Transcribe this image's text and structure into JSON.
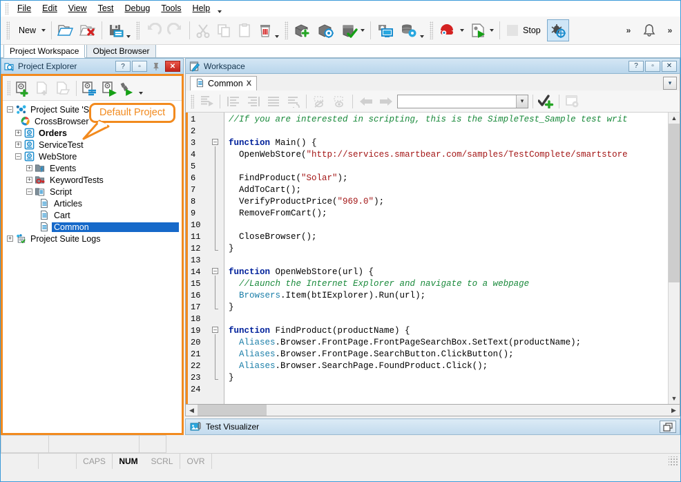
{
  "menubar": {
    "items": [
      {
        "label": "File",
        "accel": "F"
      },
      {
        "label": "Edit",
        "accel": "E"
      },
      {
        "label": "View",
        "accel": "V"
      },
      {
        "label": "Test",
        "accel": "s"
      },
      {
        "label": "Debug",
        "accel": "D"
      },
      {
        "label": "Tools",
        "accel": "T"
      },
      {
        "label": "Help",
        "accel": "H"
      }
    ],
    "overflow_icon": "chevron-down-icon"
  },
  "toolbar": {
    "new_label": "New",
    "stop_label": "Stop",
    "buttons": [
      {
        "name": "new-button",
        "icon": "new-icon"
      },
      {
        "name": "open-project-button",
        "icon": "open-folder-icon"
      },
      {
        "name": "close-project-button",
        "icon": "folder-close-red-x-icon"
      },
      {
        "name": "save-button",
        "icon": "save-floppy-icon"
      },
      {
        "name": "undo-button",
        "icon": "undo-arrow-icon"
      },
      {
        "name": "redo-button",
        "icon": "redo-arrow-icon"
      },
      {
        "name": "cut-button",
        "icon": "scissors-icon"
      },
      {
        "name": "copy-button",
        "icon": "copy-icon"
      },
      {
        "name": "paste-button",
        "icon": "paste-icon"
      },
      {
        "name": "delete-button",
        "icon": "trash-icon"
      },
      {
        "name": "add-object-button",
        "icon": "box-plus-icon"
      },
      {
        "name": "spy-object-button",
        "icon": "box-target-icon"
      },
      {
        "name": "check-object-button",
        "icon": "box-check-icon"
      },
      {
        "name": "record-screen-button",
        "icon": "monitor-camera-icon"
      },
      {
        "name": "data-settings-button",
        "icon": "database-gear-icon"
      },
      {
        "name": "record-test-button",
        "icon": "record-red-icon"
      },
      {
        "name": "run-test-button",
        "icon": "run-play-icon"
      },
      {
        "name": "stop-button",
        "icon": "stop-icon"
      },
      {
        "name": "debug-button",
        "icon": "debug-bug-icon"
      }
    ],
    "notification_icon": "bell-icon"
  },
  "workspace_tabs": {
    "items": [
      {
        "label": "Project Workspace",
        "selected": true
      },
      {
        "label": "Object Browser",
        "selected": false
      }
    ]
  },
  "project_explorer": {
    "title": "Project Explorer",
    "title_icon": "project-explorer-icon",
    "titlebar_buttons": [
      {
        "name": "help-button",
        "glyph": "?"
      },
      {
        "name": "restore-button",
        "glyph": "▭"
      },
      {
        "name": "pin-button",
        "glyph": "pin-icon"
      },
      {
        "name": "close-button",
        "glyph": "✕"
      }
    ],
    "toolbar_buttons": [
      {
        "name": "new-project-suite-button",
        "icon": "suite-plus-icon"
      },
      {
        "name": "new-item-button",
        "icon": "page-plus-icon"
      },
      {
        "name": "open-item-button",
        "icon": "page-open-icon"
      },
      {
        "name": "edit-properties-button",
        "icon": "suite-properties-icon"
      },
      {
        "name": "run-project-button",
        "icon": "suite-run-icon"
      },
      {
        "name": "run-project-suite-button",
        "icon": "run-all-icon"
      }
    ],
    "tree": [
      {
        "level": 0,
        "label": "Project Suite 'Sample'",
        "icon": "project-suite-icon",
        "expander": "-",
        "bold": false,
        "selected": false
      },
      {
        "level": 1,
        "label": "CrossBrowser",
        "icon": "crossbrowser-icon",
        "expander": "",
        "bold": false,
        "selected": false
      },
      {
        "level": 1,
        "label": "Orders",
        "icon": "project-icon",
        "expander": "+",
        "bold": true,
        "selected": false
      },
      {
        "level": 1,
        "label": "ServiceTest",
        "icon": "project-icon",
        "expander": "+",
        "bold": false,
        "selected": false
      },
      {
        "level": 1,
        "label": "WebStore",
        "icon": "project-icon",
        "expander": "-",
        "bold": false,
        "selected": false
      },
      {
        "level": 2,
        "label": "Events",
        "icon": "events-folder-icon",
        "expander": "+",
        "bold": false,
        "selected": false
      },
      {
        "level": 2,
        "label": "KeywordTests",
        "icon": "keywordtests-folder-icon",
        "expander": "+",
        "bold": false,
        "selected": false
      },
      {
        "level": 2,
        "label": "Script",
        "icon": "script-folder-icon",
        "expander": "-",
        "bold": false,
        "selected": false
      },
      {
        "level": 3,
        "label": "Articles",
        "icon": "script-unit-icon",
        "expander": "",
        "bold": false,
        "selected": false
      },
      {
        "level": 3,
        "label": "Cart",
        "icon": "script-unit-icon",
        "expander": "",
        "bold": false,
        "selected": false
      },
      {
        "level": 3,
        "label": "Common",
        "icon": "script-unit-icon",
        "expander": "",
        "bold": false,
        "selected": true
      },
      {
        "level": 0,
        "label": "Project Suite Logs",
        "icon": "suite-logs-icon",
        "expander": "+",
        "bold": false,
        "selected": false
      }
    ]
  },
  "callout": {
    "text": "Default Project",
    "color": "#f28a1e"
  },
  "workspace": {
    "title": "Workspace",
    "title_icon": "workspace-icon",
    "titlebar_buttons": [
      {
        "name": "help-button",
        "glyph": "?"
      },
      {
        "name": "restore-button",
        "glyph": "▭"
      },
      {
        "name": "close-button",
        "glyph": "✕"
      }
    ],
    "doc_tabs": [
      {
        "label": "Common",
        "icon": "script-unit-icon",
        "close": "X",
        "selected": true
      }
    ],
    "tab_overflow_icon": "chevron-down-icon"
  },
  "editor_toolbar": {
    "find_value": "",
    "find_placeholder": "",
    "buttons": [
      {
        "name": "run-script-button",
        "icon": "run-routine-icon"
      },
      {
        "name": "align-left-button",
        "icon": "indent-left-icon"
      },
      {
        "name": "align-right-button",
        "icon": "indent-right-icon"
      },
      {
        "name": "format-button",
        "icon": "format-lines-icon"
      },
      {
        "name": "undo-format-button",
        "icon": "format-undo-icon"
      },
      {
        "name": "hide-watch-button",
        "icon": "eye-off-icon"
      },
      {
        "name": "show-watch-button",
        "icon": "eye-on-icon"
      },
      {
        "name": "navigate-back-button",
        "icon": "arrow-left-icon"
      },
      {
        "name": "navigate-forward-button",
        "icon": "arrow-right-icon"
      },
      {
        "name": "add-checkpoint-button",
        "icon": "check-plus-icon"
      },
      {
        "name": "script-options-button",
        "icon": "window-gear-icon"
      }
    ]
  },
  "code": {
    "first_line": 1,
    "last_line": 24,
    "lines": [
      {
        "n": 1,
        "fold": "",
        "indent": 0,
        "tokens": [
          {
            "t": "cmt",
            "v": "//If you are interested in scripting, this is the SimpleTest_Sample test writ"
          }
        ]
      },
      {
        "n": 2,
        "fold": "",
        "indent": 0,
        "tokens": []
      },
      {
        "n": 3,
        "fold": "-",
        "indent": 0,
        "tokens": [
          {
            "t": "kw",
            "v": "function "
          },
          {
            "t": "plain",
            "v": "Main() {"
          }
        ]
      },
      {
        "n": 4,
        "fold": "|",
        "indent": 1,
        "tokens": [
          {
            "t": "plain",
            "v": "OpenWebStore("
          },
          {
            "t": "str",
            "v": "\"http://services.smartbear.com/samples/TestComplete/smartstore"
          }
        ]
      },
      {
        "n": 5,
        "fold": "|",
        "indent": 0,
        "tokens": []
      },
      {
        "n": 6,
        "fold": "|",
        "indent": 1,
        "tokens": [
          {
            "t": "plain",
            "v": "FindProduct("
          },
          {
            "t": "str",
            "v": "\"Solar\""
          },
          {
            "t": "plain",
            "v": ");"
          }
        ]
      },
      {
        "n": 7,
        "fold": "|",
        "indent": 1,
        "tokens": [
          {
            "t": "plain",
            "v": "AddToCart();"
          }
        ]
      },
      {
        "n": 8,
        "fold": "|",
        "indent": 1,
        "tokens": [
          {
            "t": "plain",
            "v": "VerifyProductPrice("
          },
          {
            "t": "str",
            "v": "\"969.0\""
          },
          {
            "t": "plain",
            "v": ");"
          }
        ]
      },
      {
        "n": 9,
        "fold": "|",
        "indent": 1,
        "tokens": [
          {
            "t": "plain",
            "v": "RemoveFromCart();"
          }
        ]
      },
      {
        "n": 10,
        "fold": "|",
        "indent": 0,
        "tokens": []
      },
      {
        "n": 11,
        "fold": "|",
        "indent": 1,
        "tokens": [
          {
            "t": "plain",
            "v": "CloseBrowser();"
          }
        ]
      },
      {
        "n": 12,
        "fold": "L",
        "indent": 0,
        "tokens": [
          {
            "t": "plain",
            "v": "}"
          }
        ]
      },
      {
        "n": 13,
        "fold": "",
        "indent": 0,
        "tokens": []
      },
      {
        "n": 14,
        "fold": "-",
        "indent": 0,
        "tokens": [
          {
            "t": "kw",
            "v": "function "
          },
          {
            "t": "plain",
            "v": "OpenWebStore(url) {"
          }
        ]
      },
      {
        "n": 15,
        "fold": "|",
        "indent": 1,
        "tokens": [
          {
            "t": "cmt",
            "v": "//Launch the Internet Explorer and navigate to a webpage"
          }
        ]
      },
      {
        "n": 16,
        "fold": "|",
        "indent": 1,
        "tokens": [
          {
            "t": "obj",
            "v": "Browsers"
          },
          {
            "t": "plain",
            "v": ".Item(btIExplorer).Run(url);"
          }
        ]
      },
      {
        "n": 17,
        "fold": "L",
        "indent": 0,
        "tokens": [
          {
            "t": "plain",
            "v": "}"
          }
        ]
      },
      {
        "n": 18,
        "fold": "",
        "indent": 0,
        "tokens": []
      },
      {
        "n": 19,
        "fold": "-",
        "indent": 0,
        "tokens": [
          {
            "t": "kw",
            "v": "function "
          },
          {
            "t": "plain",
            "v": "FindProduct(productName) {"
          }
        ]
      },
      {
        "n": 20,
        "fold": "|",
        "indent": 1,
        "tokens": [
          {
            "t": "obj",
            "v": "Aliases"
          },
          {
            "t": "plain",
            "v": ".Browser.FrontPage.FrontPageSearchBox.SetText(productName);"
          }
        ]
      },
      {
        "n": 21,
        "fold": "|",
        "indent": 1,
        "tokens": [
          {
            "t": "obj",
            "v": "Aliases"
          },
          {
            "t": "plain",
            "v": ".Browser.FrontPage.SearchButton.ClickButton();"
          }
        ]
      },
      {
        "n": 22,
        "fold": "|",
        "indent": 1,
        "tokens": [
          {
            "t": "obj",
            "v": "Aliases"
          },
          {
            "t": "plain",
            "v": ".Browser.SearchPage.FoundProduct.Click();"
          }
        ]
      },
      {
        "n": 23,
        "fold": "L",
        "indent": 0,
        "tokens": [
          {
            "t": "plain",
            "v": "}"
          }
        ]
      },
      {
        "n": 24,
        "fold": "",
        "indent": 0,
        "tokens": []
      }
    ]
  },
  "test_visualizer": {
    "title": "Test Visualizer",
    "icon": "test-visualizer-icon",
    "button_icon": "restore-windows-icon"
  },
  "statusbar": {
    "indicators": [
      {
        "label": "CAPS",
        "on": false
      },
      {
        "label": "NUM",
        "on": true
      },
      {
        "label": "SCRL",
        "on": false
      },
      {
        "label": "OVR",
        "on": false
      }
    ],
    "resize_grip_icon": "resize-grip-icon"
  }
}
